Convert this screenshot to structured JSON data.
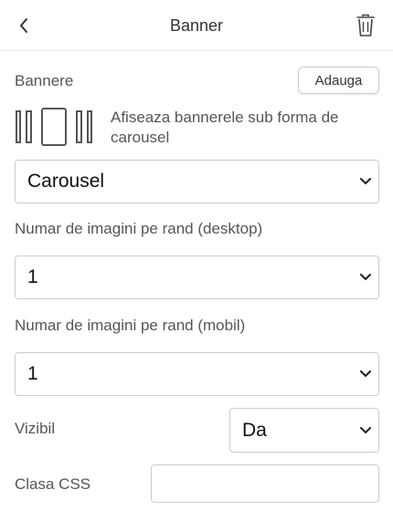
{
  "header": {
    "title": "Banner",
    "back_icon": "chevron-left-icon",
    "delete_icon": "trash-icon"
  },
  "banners": {
    "label": "Bannere",
    "add_label": "Adauga",
    "carousel_icon": "carousel-icon",
    "description": "Afiseaza bannerele sub forma de carousel"
  },
  "display_mode": {
    "selected": "Carousel"
  },
  "desktop_count": {
    "label": "Numar de imagini pe rand (desktop)",
    "selected": "1"
  },
  "mobile_count": {
    "label": "Numar de imagini pe rand (mobil)",
    "selected": "1"
  },
  "visible": {
    "label": "Vizibil",
    "selected": "Da"
  },
  "css_class": {
    "label": "Clasa CSS",
    "value": "",
    "placeholder": ""
  },
  "colors": {
    "border": "#cccccc",
    "label_text": "#555555",
    "value_text": "#111111"
  }
}
